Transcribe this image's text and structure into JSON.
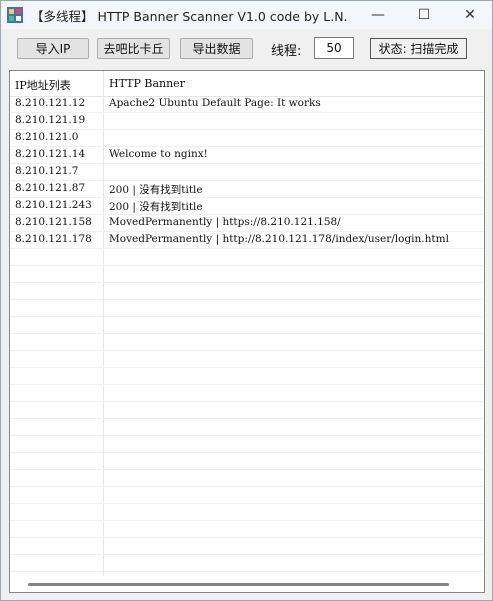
{
  "window": {
    "title": "【多线程】 HTTP Banner Scanner V1.0   code by L.N.",
    "minimize_glyph": "—",
    "maximize_glyph": "☐",
    "close_glyph": "✕"
  },
  "toolbar": {
    "import_label": "导入IP",
    "qbbkq_label": "去吧比卡丘",
    "export_label": "导出数据",
    "thread_label": "线程:",
    "thread_value": "50",
    "status_label": "状态: 扫描完成"
  },
  "table": {
    "columns": [
      "IP地址列表",
      "HTTP Banner"
    ],
    "rows": [
      {
        "ip": "8.210.121.12",
        "banner": "Apache2 Ubuntu Default Page: It works"
      },
      {
        "ip": "8.210.121.19",
        "banner": ""
      },
      {
        "ip": "8.210.121.0",
        "banner": ""
      },
      {
        "ip": "8.210.121.14",
        "banner": "Welcome to nginx!"
      },
      {
        "ip": "8.210.121.7",
        "banner": ""
      },
      {
        "ip": "8.210.121.87",
        "banner": "200 | 没有找到title"
      },
      {
        "ip": "8.210.121.243",
        "banner": "200 | 没有找到title"
      },
      {
        "ip": "8.210.121.158",
        "banner": "MovedPermanently | https://8.210.121.158/"
      },
      {
        "ip": "8.210.121.178",
        "banner": "MovedPermanently | http://8.210.121.178/index/user/login.html"
      },
      {
        "ip": "",
        "banner": ""
      },
      {
        "ip": "",
        "banner": ""
      },
      {
        "ip": "",
        "banner": ""
      },
      {
        "ip": "",
        "banner": ""
      },
      {
        "ip": "",
        "banner": ""
      },
      {
        "ip": "",
        "banner": ""
      },
      {
        "ip": "",
        "banner": ""
      },
      {
        "ip": "",
        "banner": ""
      },
      {
        "ip": "",
        "banner": ""
      },
      {
        "ip": "",
        "banner": ""
      },
      {
        "ip": "",
        "banner": ""
      },
      {
        "ip": "",
        "banner": ""
      },
      {
        "ip": "",
        "banner": ""
      },
      {
        "ip": "",
        "banner": ""
      },
      {
        "ip": "",
        "banner": ""
      },
      {
        "ip": "",
        "banner": ""
      },
      {
        "ip": "",
        "banner": ""
      },
      {
        "ip": "",
        "banner": ""
      },
      {
        "ip": "",
        "banner": ""
      },
      {
        "ip": "",
        "banner": ""
      }
    ]
  }
}
